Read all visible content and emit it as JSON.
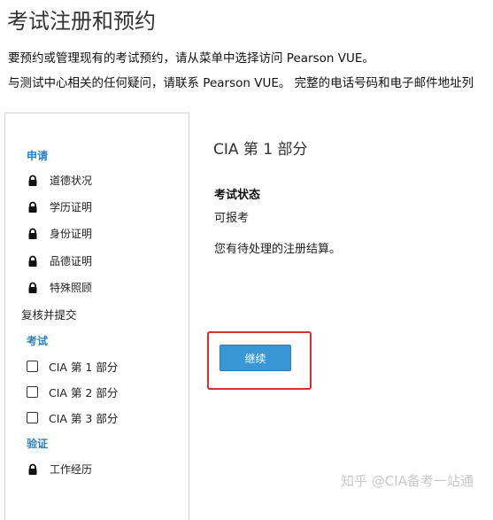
{
  "page": {
    "title": "考试注册和预约",
    "intro_line_1": "要预约或管理现有的考试预约，请从菜单中选择访问 Pearson VUE。",
    "intro_line_2": "与测试中心相关的任何疑问，请联系 Pearson VUE。 完整的电话号码和电子邮件地址列"
  },
  "sidebar": {
    "application_header": "申请",
    "application_items": [
      {
        "label": "道德状况",
        "icon": "lock-icon"
      },
      {
        "label": "学历证明",
        "icon": "lock-icon"
      },
      {
        "label": "身份证明",
        "icon": "lock-icon"
      },
      {
        "label": "品德证明",
        "icon": "lock-icon"
      },
      {
        "label": "特殊照顾",
        "icon": "lock-icon"
      }
    ],
    "review_submit": "复核并提交",
    "exam_header": "考试",
    "exam_items": [
      {
        "label": "CIA 第 1 部分",
        "checked": false
      },
      {
        "label": "CIA 第 2 部分",
        "checked": false
      },
      {
        "label": "CIA 第 3 部分",
        "checked": false
      }
    ],
    "verify_header": "验证",
    "verify_items": [
      {
        "label": "工作经历",
        "icon": "lock-icon"
      }
    ]
  },
  "main": {
    "exam_title": "CIA 第 1 部分",
    "status_label": "考试状态",
    "status_value": "可报考",
    "pending_message": "您有待处理的注册结算。",
    "continue_label": "继续"
  },
  "watermark": "知乎 @CIA备考一站通",
  "colors": {
    "accent_blue": "#2b7fc0",
    "button_blue": "#3a97d6",
    "highlight_red": "#d9302e"
  }
}
